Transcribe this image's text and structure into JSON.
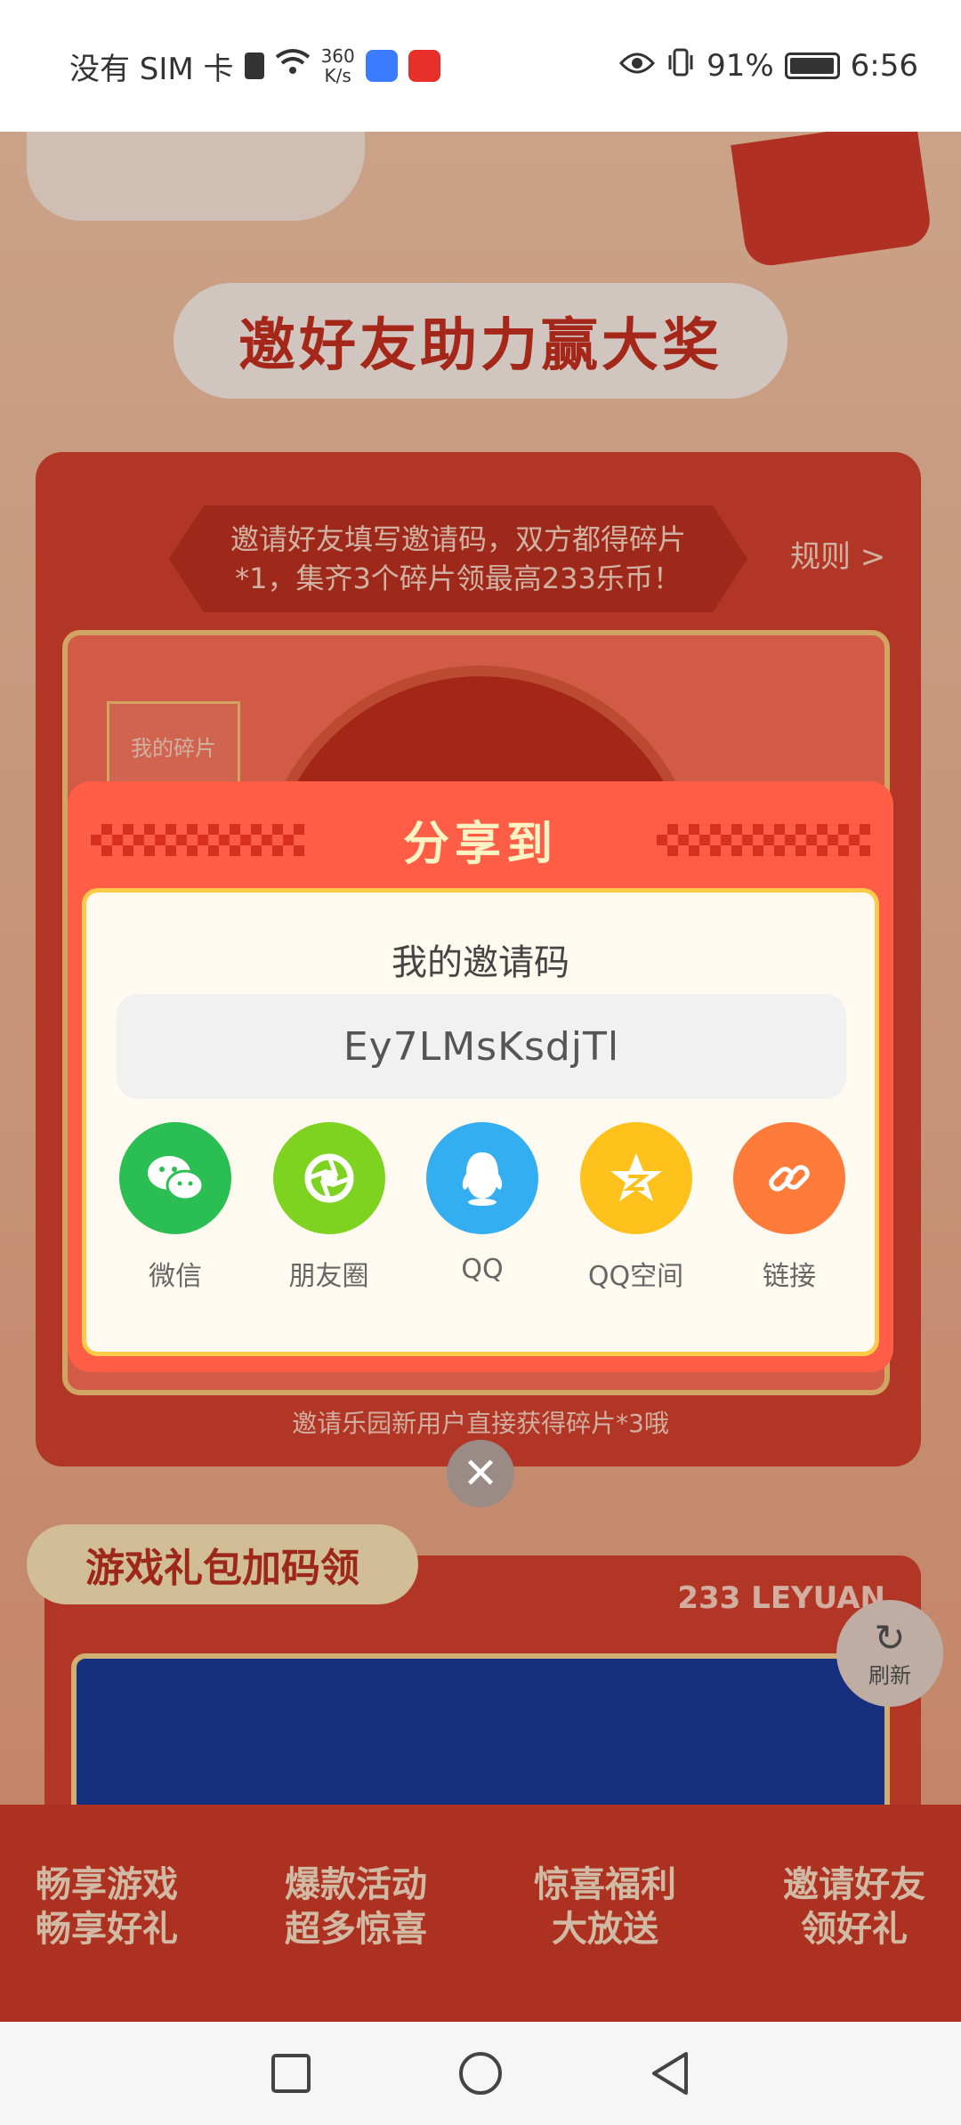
{
  "status_bar": {
    "carrier": "没有 SIM 卡",
    "net_speed_value": "360",
    "net_speed_unit": "K/s",
    "battery_percent": "91%",
    "time": "6:56"
  },
  "background_page": {
    "heading": "邀好友助力赢大奖",
    "notice_line1": "邀请好友填写邀请码，双方都得碎片",
    "notice_line2": "*1，集齐3个碎片领最高233乐币！",
    "rules_link": "规则 >",
    "my_fragments_tag": "我的碎片",
    "footnote": "邀请乐园新用户直接获得碎片*3哦",
    "game_section_title": "游戏礼包加码领",
    "leyuan_text": "233 LEYUAN",
    "refresh_label": "刷新",
    "features": [
      {
        "line1": "畅享游戏",
        "line2": "畅享好礼"
      },
      {
        "line1": "爆款活动",
        "line2": "超多惊喜"
      },
      {
        "line1": "惊喜福利",
        "line2": "大放送"
      },
      {
        "line1": "邀请好友",
        "line2": "领好礼"
      }
    ]
  },
  "share_dialog": {
    "title": "分享到",
    "code_label": "我的邀请码",
    "invite_code": "Ey7LMsKsdjTl",
    "targets": [
      {
        "label": "微信",
        "icon": "wechat-icon",
        "color": "#2bbe52"
      },
      {
        "label": "朋友圈",
        "icon": "moments-icon",
        "color": "#7ed321"
      },
      {
        "label": "QQ",
        "icon": "qq-icon",
        "color": "#33aef0"
      },
      {
        "label": "QQ空间",
        "icon": "qzone-icon",
        "color": "#ffc21c"
      },
      {
        "label": "链接",
        "icon": "link-icon",
        "color": "#ff7b3a"
      }
    ]
  },
  "colors": {
    "accent": "#ff5d45",
    "dialog_body": "#fffaf0"
  }
}
